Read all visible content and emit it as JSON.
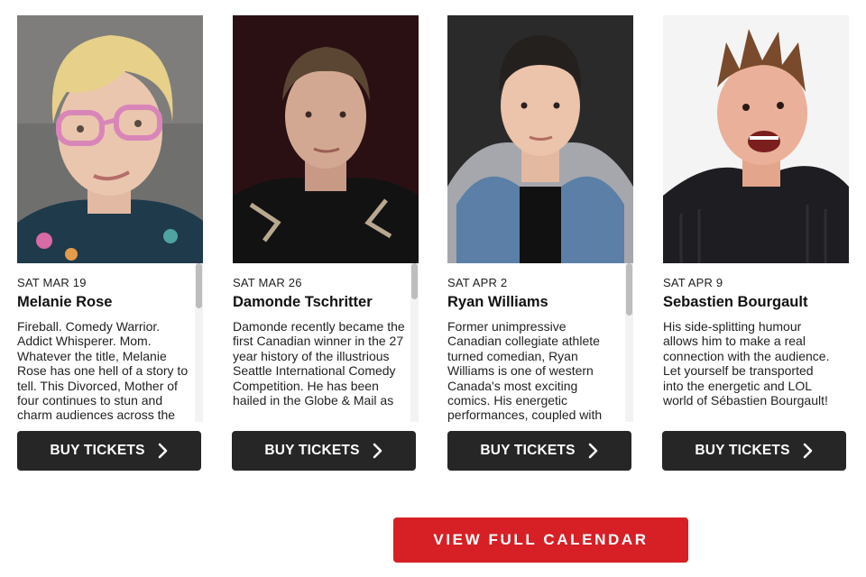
{
  "performers": [
    {
      "date": "SAT MAR 19",
      "name": "Melanie Rose",
      "description": "Fireball. Comedy Warrior. Addict Whisperer. Mom. Whatever the title, Melanie Rose has one hell of a story to tell. This Divorced, Mother of four continues to stun and charm audiences across the",
      "button": "BUY TICKETS",
      "scroll_position": 0.0
    },
    {
      "date": "SAT MAR 26",
      "name": "Damonde Tschritter",
      "description": "Damonde recently became the first Canadian winner in the 27 year history of the illustrious Seattle International Comedy Competition. He has been hailed in the Globe & Mail as",
      "button": "BUY TICKETS",
      "scroll_position": 0.0
    },
    {
      "date": "SAT APR 2",
      "name": "Ryan Williams",
      "description": "Former unimpressive Canadian collegiate athlete turned comedian, Ryan Williams is one of western Canada's most exciting comics. His energetic performances, coupled with",
      "button": "BUY TICKETS",
      "scroll_position": 0.0
    },
    {
      "date": "SAT APR 9",
      "name": "Sebastien Bourgault",
      "description": "His side-splitting humour allows him to make a real connection with the audience. Let yourself be transported into the energetic and LOL world of Sébastien Bourgault!",
      "button": "BUY TICKETS"
    }
  ],
  "calendar_button": "VIEW FULL CALENDAR",
  "colors": {
    "buy_button": "#262626",
    "calendar_button": "#d71f26",
    "scroll_thumb": "#bdbdbd"
  },
  "icons": {
    "buy_button_icon": "chevron-right-icon"
  }
}
